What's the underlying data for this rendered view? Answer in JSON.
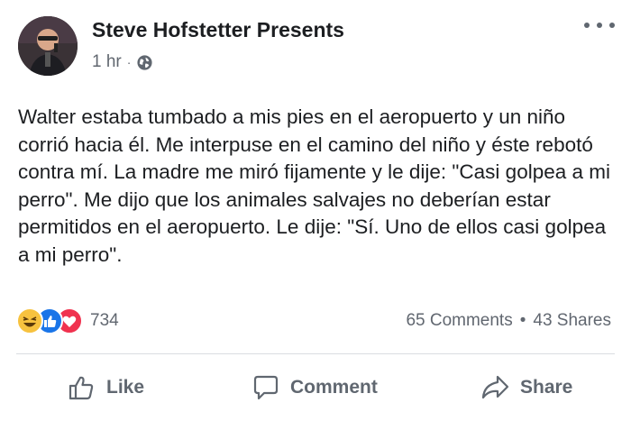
{
  "post": {
    "author": "Steve Hofstetter Presents",
    "time": "1 hr",
    "separator": "·",
    "body": "Walter estaba tumbado a mis pies en el aeropuerto y un niño corrió hacia él. Me interpuse en el camino del niño y éste rebotó contra mí. La madre me miró fijamente y le dije: \"Casi golpea a mi perro\". Me dijo que los animales salvajes no deberían estar permitidos en el aeropuerto. Le dije: \"Sí. Uno de ellos casi golpea a mi perro\"."
  },
  "reactions": {
    "types": [
      "haha",
      "like",
      "love"
    ],
    "count": "734"
  },
  "stats": {
    "comments": "65 Comments",
    "separator": "•",
    "shares": "43 Shares"
  },
  "actions": {
    "like": "Like",
    "comment": "Comment",
    "share": "Share"
  },
  "colors": {
    "like_blue": "#1a75e8",
    "love_red": "#f0324f",
    "haha_yellow": "#f7c23f",
    "muted_text": "#616770"
  }
}
